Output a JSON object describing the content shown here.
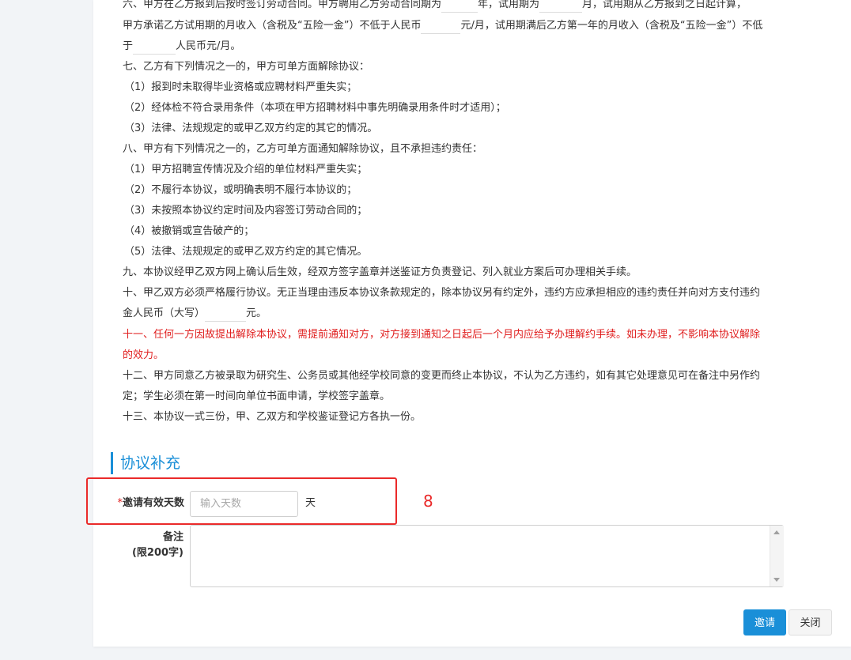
{
  "agreement": {
    "clause6_line1": {
      "a": "六、甲方在乙方报到后按时签订劳动合同。甲方聘用乙方劳动合同期为",
      "b": "年，试用期为",
      "c": "月，试用期从乙方报到之日起计算，"
    },
    "clause6_line2": {
      "a": "甲方承诺乙方试用期的月收入（含税及“五险一金”）不低于人民币",
      "b": "元/月，试用期满后乙方第一年的月收入（含税及“五险一金”）不低"
    },
    "clause6_line3": {
      "a": "于",
      "b": "人民币元/月。"
    },
    "clause7_title": "七、乙方有下列情况之一的，甲方可单方面解除协议：",
    "clause7_items": [
      "（1）报到时未取得毕业资格或应聘材料严重失实；",
      "（2）经体检不符合录用条件（本项在甲方招聘材料中事先明确录用条件时才适用）；",
      "（3）法律、法规规定的或甲乙双方约定的其它的情况。"
    ],
    "clause8_title": "八、甲方有下列情况之一的，乙方可单方面通知解除协议，且不承担违约责任：",
    "clause8_items": [
      "（1）甲方招聘宣传情况及介绍的单位材料严重失实；",
      "（2）不履行本协议，或明确表明不履行本协议的；",
      "（3）未按照本协议约定时间及内容签订劳动合同的；",
      "（4）被撤销或宣告破产的；",
      "（5）法律、法规规定的或甲乙双方约定的其它情况。"
    ],
    "clause9": "九、本协议经甲乙双方网上确认后生效，经双方签字盖章并送鉴证方负责登记、列入就业方案后可办理相关手续。",
    "clause10_line1": "十、甲乙双方必须严格履行协议。无正当理由违反本协议条款规定的，除本协议另有约定外，违约方应承担相应的违约责任并向对方支付违约",
    "clause10_line2": {
      "a": "金人民币（大写）",
      "b": "元。"
    },
    "clause11_line1": "十一、任何一方因故提出解除本协议，需提前通知对方，对方接到通知之日起后一个月内应给予办理解约手续。如未办理，不影响本协议解除",
    "clause11_line2": "的效力。",
    "clause12_line1": "十二、甲方同意乙方被录取为研究生、公务员或其他经学校同意的变更而终止本协议，不认为乙方违约，如有其它处理意见可在备注中另作约",
    "clause12_line2": "定；学生必须在第一时间向单位书面申请，学校签字盖章。",
    "clause13": "十三、本协议一式三份，甲、乙双方和学校鉴证登记方各执一份。"
  },
  "supplement": {
    "section_title": "协议补充",
    "days_field": {
      "required_mark": "*",
      "label": "邀请有效天数",
      "placeholder": "输入天数",
      "value": "",
      "unit": "天"
    },
    "remarks_field": {
      "label_line1": "备注",
      "label_line2": "(限200字)",
      "value": ""
    }
  },
  "annotation": {
    "number": "8",
    "color": "#ea2a2a"
  },
  "actions": {
    "invite_label": "邀请",
    "close_label": "关闭"
  },
  "colors": {
    "primary": "#1a8fd8",
    "alert_text": "#e02020"
  }
}
